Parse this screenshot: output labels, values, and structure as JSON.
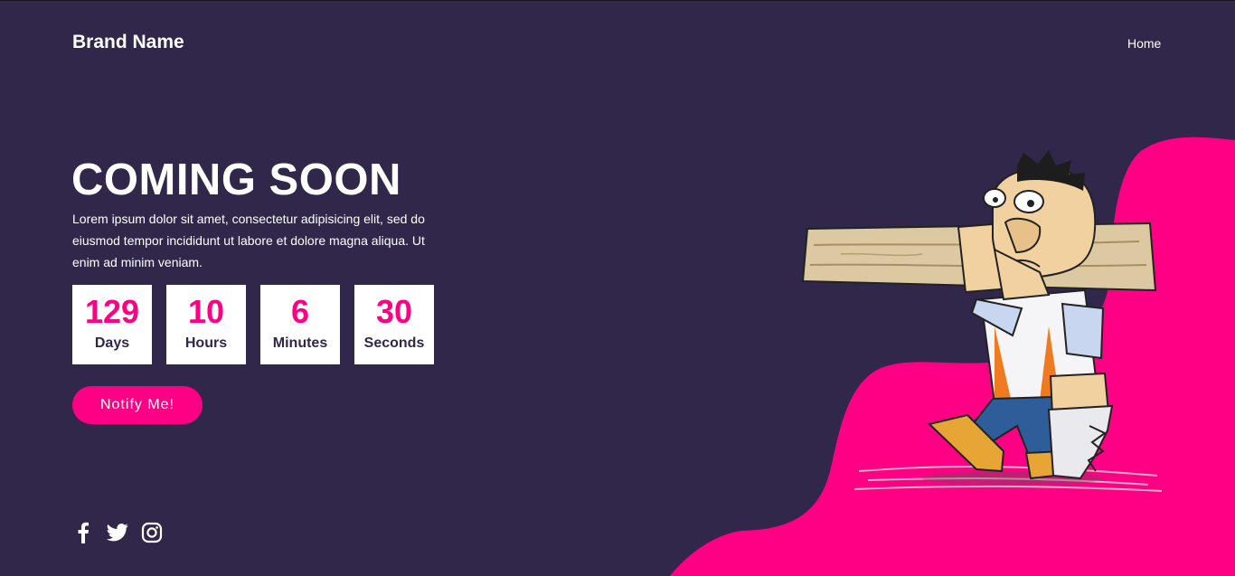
{
  "header": {
    "brand": "Brand Name",
    "nav": {
      "home": "Home"
    }
  },
  "hero": {
    "title": "COMING SOON",
    "description": "Lorem ipsum dolor sit amet, consectetur adipisicing elit, sed do eiusmod tempor incididunt ut labore et dolore magna aliqua. Ut enim ad minim veniam.",
    "countdown": [
      {
        "value": "129",
        "label": "Days"
      },
      {
        "value": "10",
        "label": "Hours"
      },
      {
        "value": "6",
        "label": "Minutes"
      },
      {
        "value": "30",
        "label": "Seconds"
      }
    ],
    "cta": "Notify Me!"
  },
  "social": [
    "facebook-icon",
    "twitter-icon",
    "instagram-icon"
  ],
  "colors": {
    "background": "#31274a",
    "accent": "#ff0084",
    "text": "#ffffff"
  }
}
